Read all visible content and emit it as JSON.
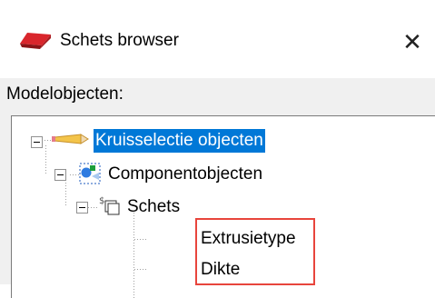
{
  "window": {
    "title": "Schets browser",
    "close_symbol": "✕",
    "icon": "schets-browser-icon"
  },
  "panel": {
    "label": "Modelobjecten:"
  },
  "tree": {
    "nodes": [
      {
        "label": "Kruisselectie objecten",
        "icon": "pencil-icon",
        "expanded": true,
        "selected": true
      },
      {
        "label": "Componentobjecten",
        "icon": "component-objects-icon",
        "expanded": true,
        "selected": false
      },
      {
        "label": "Schets",
        "icon": "sketch-icon",
        "expanded": true,
        "selected": false
      },
      {
        "label": "Extrusietype",
        "icon": null,
        "selected": false
      },
      {
        "label": "Dikte",
        "icon": null,
        "selected": false
      }
    ]
  },
  "colors": {
    "selection": "#0078d7",
    "highlight_border": "#e8453c",
    "panel_bg": "#f0f0f0",
    "title_icon_red": "#d9262c"
  }
}
